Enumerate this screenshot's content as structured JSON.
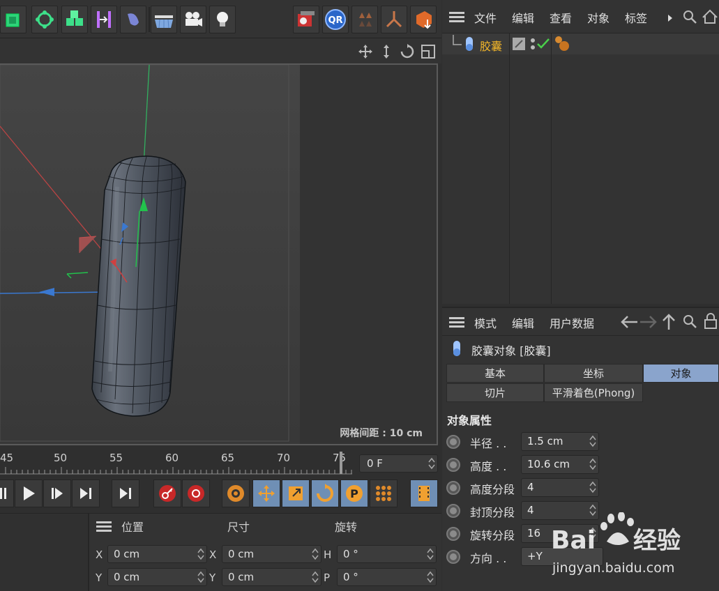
{
  "viewport": {
    "grid_spacing_label": "网格间距 : 10 cm"
  },
  "timeline": {
    "ticks": [
      "45",
      "50",
      "55",
      "60",
      "65",
      "70",
      "75"
    ],
    "current_frame": "0 F"
  },
  "coordinates": {
    "headers": {
      "position": "位置",
      "size": "尺寸",
      "rotation": "旋转"
    },
    "position": {
      "x_axis": "X",
      "y_axis": "Y",
      "x": "0 cm",
      "y": "0 cm"
    },
    "size": {
      "x_axis": "X",
      "y_axis": "Y",
      "x": "0 cm",
      "y": "0 cm"
    },
    "rotation": {
      "h_axis": "H",
      "p_axis": "P",
      "h": "0 °",
      "p": "0 °"
    }
  },
  "object_manager": {
    "menu": [
      "文件",
      "编辑",
      "查看",
      "对象",
      "标签"
    ],
    "objects": [
      {
        "name": "胶囊",
        "icon": "capsule-icon"
      }
    ]
  },
  "attributes": {
    "menu": [
      "模式",
      "编辑",
      "用户数据"
    ],
    "object_title": "胶囊对象 [胶囊]",
    "tabs_row1": [
      "基本",
      "坐标",
      "对象"
    ],
    "tabs_row2": [
      "切片",
      "平滑着色(Phong)"
    ],
    "active_tab": "对象",
    "section_title": "对象属性",
    "properties": [
      {
        "label": "半径 . .",
        "value": "1.5 cm"
      },
      {
        "label": "高度 . .",
        "value": "10.6 cm"
      },
      {
        "label": "高度分段",
        "value": "4"
      },
      {
        "label": "封顶分段",
        "value": "4"
      },
      {
        "label": "旋转分段",
        "value": "16"
      },
      {
        "label": "方向 . .",
        "value": "+Y"
      }
    ]
  },
  "watermark": {
    "brand": "Bai du 经验",
    "url": "jingyan.baidu.com"
  },
  "colors": {
    "accent": "#8aa4cc",
    "object_name": "#f0b429",
    "highlight": "#6f8fb5"
  }
}
